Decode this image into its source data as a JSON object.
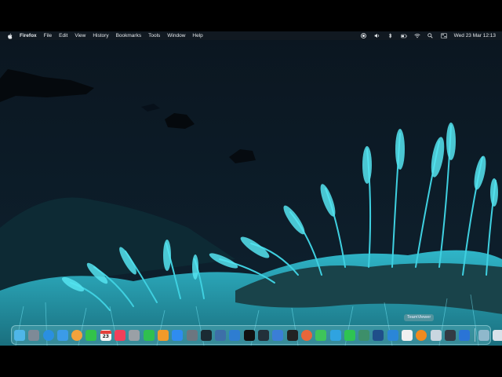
{
  "menubar": {
    "app_name": "Firefox",
    "menus": [
      "File",
      "Edit",
      "View",
      "History",
      "Bookmarks",
      "Tools",
      "Window",
      "Help"
    ],
    "status_icons": [
      "screen-record-icon",
      "volume-icon",
      "bluetooth-icon",
      "battery-icon",
      "wifi-icon",
      "search-icon",
      "control-center-icon"
    ],
    "clock": "Wed 23 Mar  12:13"
  },
  "dock": {
    "calendar_day": "23",
    "tooltip": "TeamViewer",
    "apps": [
      {
        "name": "finder-icon",
        "color": "#4fb6e8"
      },
      {
        "name": "launchpad-icon",
        "color": "#7e8a97"
      },
      {
        "name": "safari-icon",
        "color": "#2a8fe0"
      },
      {
        "name": "mail-icon",
        "color": "#3b9be8"
      },
      {
        "name": "photos-icon",
        "color": "#f2a23c"
      },
      {
        "name": "facetime-icon",
        "color": "#32c34a"
      },
      {
        "name": "calendar-icon",
        "color": "#f4f4f4"
      },
      {
        "name": "music-icon",
        "color": "#f0405a"
      },
      {
        "name": "calculator-icon",
        "color": "#9aa0a6"
      },
      {
        "name": "numbers-icon",
        "color": "#2fbf4f"
      },
      {
        "name": "pages-icon",
        "color": "#f09a2a"
      },
      {
        "name": "app-store-icon",
        "color": "#2f8cf0"
      },
      {
        "name": "disk-utility-icon",
        "color": "#6c7680"
      },
      {
        "name": "pycharm-icon",
        "color": "#1b2b33"
      },
      {
        "name": "python-icon",
        "color": "#3d6fa8"
      },
      {
        "name": "idle-icon",
        "color": "#2e7dd1"
      },
      {
        "name": "jetbrains-icon",
        "color": "#111"
      },
      {
        "name": "pycharm-ce-icon",
        "color": "#22303a"
      },
      {
        "name": "xcode-icon",
        "color": "#3b7ed6"
      },
      {
        "name": "terminal-icon",
        "color": "#222"
      },
      {
        "name": "firefox-icon",
        "color": "#e8663a"
      },
      {
        "name": "messages-icon",
        "color": "#3ec45a"
      },
      {
        "name": "telegram-icon",
        "color": "#2fa3e0"
      },
      {
        "name": "whatsapp-icon",
        "color": "#2ec452"
      },
      {
        "name": "android-studio-icon",
        "color": "#3d8f6a"
      },
      {
        "name": "virtualbox-icon",
        "color": "#1f4f8a"
      },
      {
        "name": "vscode-icon",
        "color": "#2a86d8"
      },
      {
        "name": "textedit-icon",
        "color": "#f0f0f0"
      },
      {
        "name": "vlc-icon",
        "color": "#f08a1e"
      },
      {
        "name": "preview-icon",
        "color": "#c9d6e0"
      },
      {
        "name": "keynote-icon",
        "color": "#333a44"
      },
      {
        "name": "teamviewer-icon",
        "color": "#2a74d6"
      }
    ],
    "right_items": [
      {
        "name": "downloads-folder-icon",
        "color": "#8fb8cc"
      },
      {
        "name": "documents-stack-icon",
        "color": "#d8e2ea"
      },
      {
        "name": "folder-icon",
        "color": "#6cb2e0"
      },
      {
        "name": "trash-icon",
        "color": "#b8c6cf"
      }
    ]
  }
}
